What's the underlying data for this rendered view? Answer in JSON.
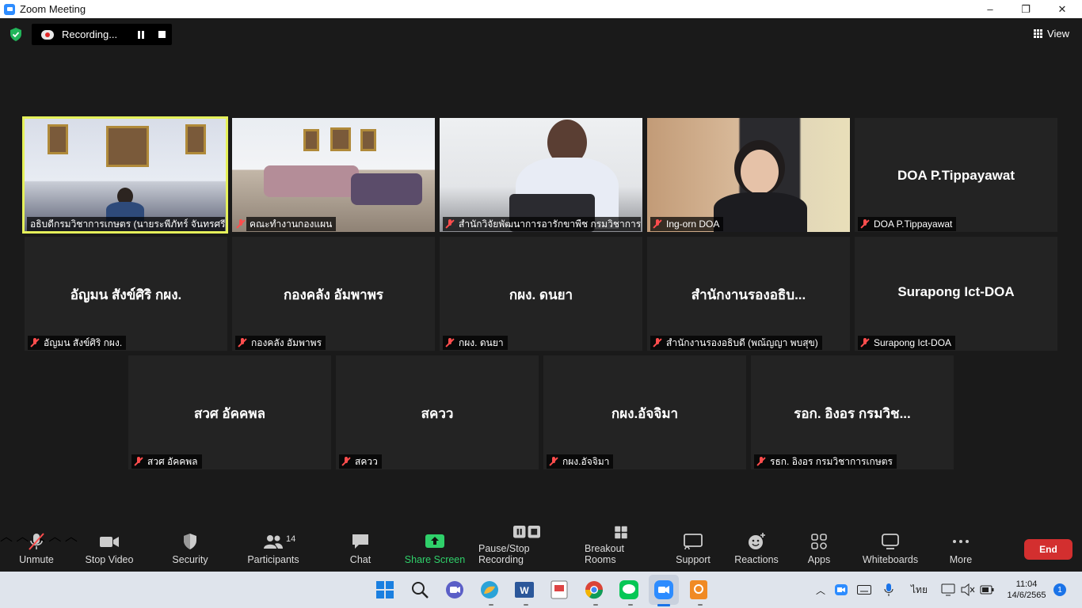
{
  "window": {
    "title": "Zoom Meeting",
    "controls": [
      "–",
      "❐",
      "✕"
    ]
  },
  "recording": {
    "status": "Recording..."
  },
  "view": {
    "label": "View"
  },
  "tiles_row1": [
    {
      "display": "",
      "label": "อธิบดีกรมวิชาการเกษตร (นายระพีภัทร์ จันทรศรีว...",
      "video": true
    },
    {
      "display": "",
      "label": "คณะทำงานกองแผน",
      "video": true
    },
    {
      "display": "",
      "label": "สำนักวิจัยพัฒนาการอารักขาพืช กรมวิชาการ...",
      "video": true
    },
    {
      "display": "",
      "label": "Ing-orn DOA",
      "video": true
    },
    {
      "display": "DOA P.Tippayawat",
      "label": "DOA P.Tippayawat",
      "video": false
    }
  ],
  "tiles_row2": [
    {
      "display": "อัญมน สังข์ศิริ กผง.",
      "label": "อัญมน สังข์ศิริ กผง."
    },
    {
      "display": "กองคลัง อัมพาพร",
      "label": "กองคลัง อัมพาพร"
    },
    {
      "display": "กผง. ดนยา",
      "label": "กผง. ดนยา"
    },
    {
      "display": "สำนักงานรองอธิบ...",
      "label": "สำนักงานรองอธิบดี (พณ้ญญา พบสุข)"
    },
    {
      "display": "Surapong Ict-DOA",
      "label": "Surapong Ict-DOA"
    }
  ],
  "tiles_row3": [
    {
      "display": "สวศ อัคคพล",
      "label": "สวศ อัคคพล"
    },
    {
      "display": "สควว",
      "label": "สควว"
    },
    {
      "display": "กผง.อัจจิมา",
      "label": "กผง.อัจจิมา"
    },
    {
      "display": "รอก. อิงอร กรมวิช...",
      "label": "รธก. อิงอร กรมวิชาการเกษตร"
    }
  ],
  "toolbar": {
    "unmute": "Unmute",
    "stop_video": "Stop Video",
    "security": "Security",
    "participants": "Participants",
    "participants_count": "14",
    "chat": "Chat",
    "share_screen": "Share Screen",
    "recording": "Pause/Stop Recording",
    "breakout": "Breakout Rooms",
    "support": "Support",
    "reactions": "Reactions",
    "apps": "Apps",
    "whiteboards": "Whiteboards",
    "more": "More",
    "end": "End"
  },
  "taskbar": {
    "lang": "ไทย",
    "time": "11:04",
    "date": "14/6/2565",
    "notifications": "1"
  },
  "colors": {
    "active_speaker": "#e5f15a",
    "share_green": "#2fd06a",
    "end_red": "#d32f2f"
  }
}
